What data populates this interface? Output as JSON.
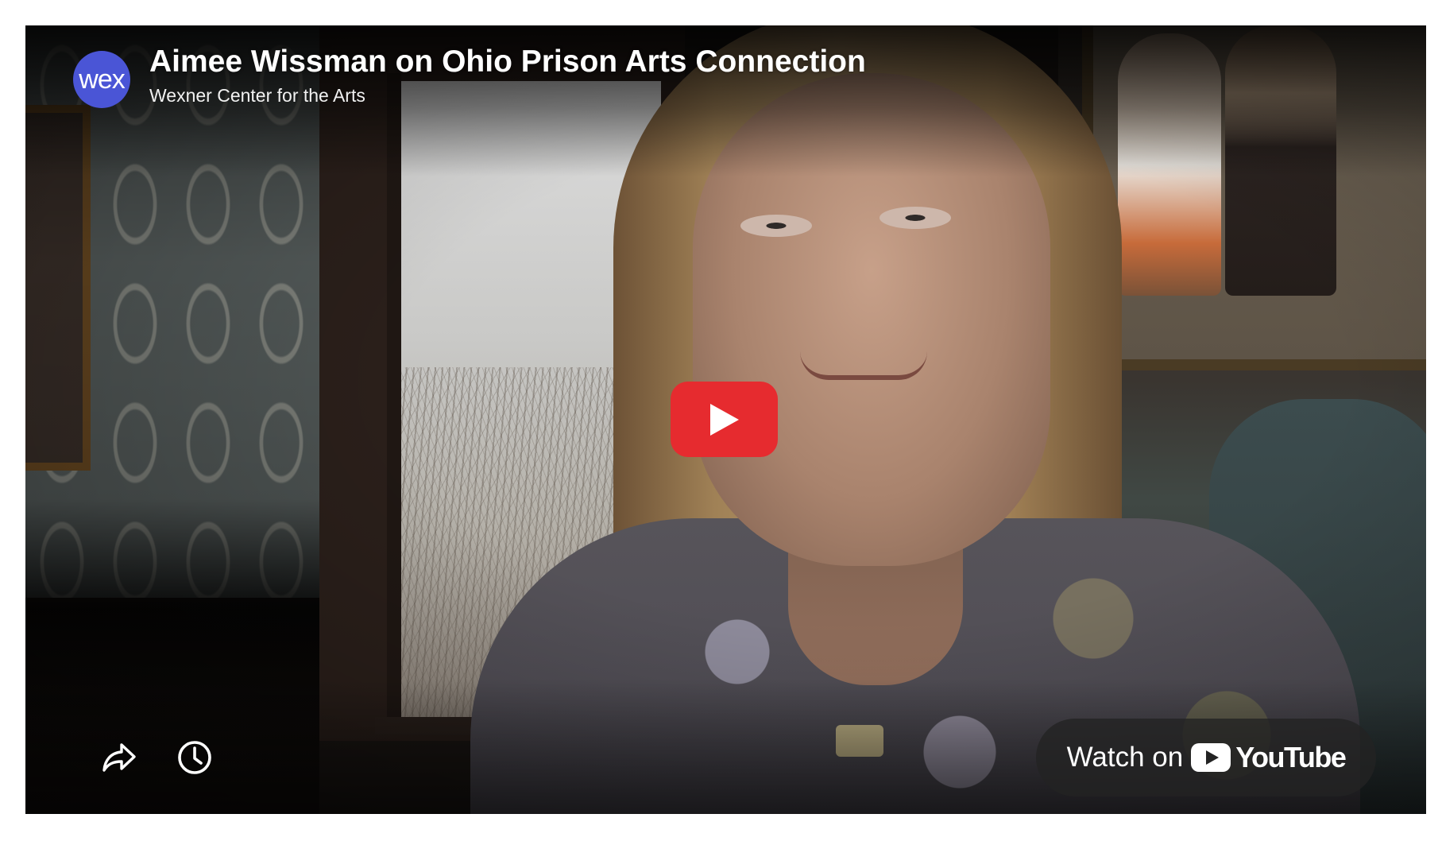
{
  "video": {
    "title": "Aimee Wissman on Ohio Prison Arts Connection",
    "channel": "Wexner Center for the Arts",
    "channel_avatar_text": "wex"
  },
  "controls": {
    "play_icon": "play-icon",
    "share_icon": "share-arrow-icon",
    "watch_later_icon": "clock-icon",
    "watch_on_label": "Watch on",
    "youtube_word": "YouTube"
  },
  "colors": {
    "play_button": "#e62b2f",
    "avatar_background": "#4a55d6",
    "watch_on_pill": "#232323"
  }
}
